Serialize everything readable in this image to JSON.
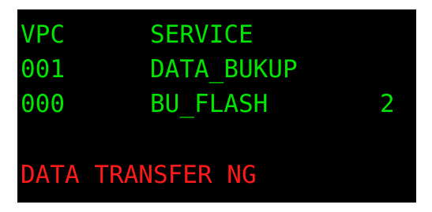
{
  "header": {
    "col1": "VPC",
    "col2": "SERVICE"
  },
  "rows": [
    {
      "vpc": "001",
      "service": "DATA_BUKUP",
      "value": ""
    },
    {
      "vpc": "000",
      "service": "BU_FLASH",
      "value": "2"
    }
  ],
  "status": {
    "message": "DATA TRANSFER NG"
  },
  "colors": {
    "background": "#000000",
    "text_normal": "#00e600",
    "text_error": "#ff1a1a"
  }
}
